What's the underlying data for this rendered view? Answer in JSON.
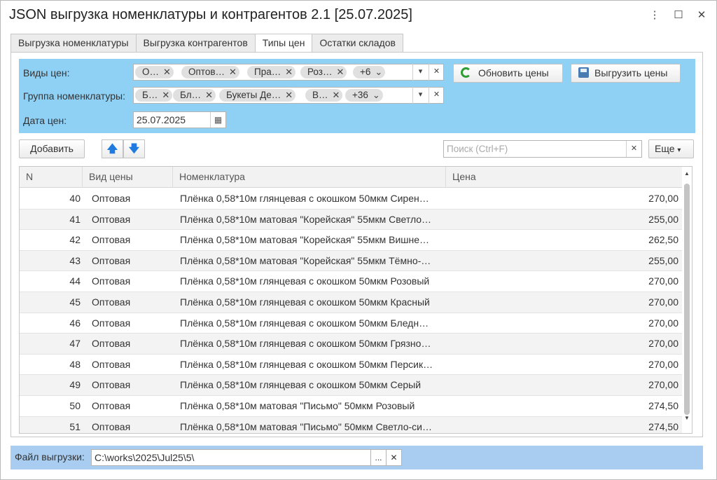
{
  "window": {
    "title": "JSON выгрузка номенклатуры и контрагентов 2.1 [25.07.2025]",
    "more_icon": "⋮",
    "maximize_icon": "☐",
    "close_icon": "✕"
  },
  "tabs": [
    {
      "label": "Выгрузка номенклатуры",
      "active": false
    },
    {
      "label": "Выгрузка контрагентов",
      "active": false
    },
    {
      "label": "Типы цен",
      "active": true
    },
    {
      "label": "Остатки складов",
      "active": false
    }
  ],
  "filter": {
    "background": "#8fd0f5",
    "price_types": {
      "label": "Виды цен:",
      "chips": [
        "О…",
        "Оптов…",
        "Пра…",
        "Роз…"
      ],
      "more": "+6"
    },
    "nom_group": {
      "label": "Группа номенклатуры:",
      "chips": [
        "Б…",
        "Бл…",
        "Букеты Де…",
        "В…"
      ],
      "more": "+36"
    },
    "date": {
      "label": "Дата цен:",
      "value": "25.07.2025"
    },
    "refresh_button": "Обновить цены",
    "export_button": "Выгрузить цены"
  },
  "toolbar": {
    "add_button": "Добавить",
    "move_up_icon": "🡅",
    "move_down_icon": "🡇",
    "search_placeholder": "Поиск (Ctrl+F)",
    "more_button": "Еще"
  },
  "table": {
    "columns": [
      "N",
      "Вид цены",
      "Номенклатура",
      "Цена"
    ],
    "rows": [
      {
        "n": "40",
        "type": "Оптовая",
        "nom": "Плёнка 0,58*10м глянцевая с окошком 50мкм Сирен…",
        "price": "270,00"
      },
      {
        "n": "41",
        "type": "Оптовая",
        "nom": "Плёнка 0,58*10м матовая \"Корейская\" 55мкм Светло…",
        "price": "255,00"
      },
      {
        "n": "42",
        "type": "Оптовая",
        "nom": "Плёнка 0,58*10м матовая \"Корейская\" 55мкм Вишне…",
        "price": "262,50"
      },
      {
        "n": "43",
        "type": "Оптовая",
        "nom": "Плёнка 0,58*10м матовая \"Корейская\" 55мкм Тёмно-…",
        "price": "255,00"
      },
      {
        "n": "44",
        "type": "Оптовая",
        "nom": "Плёнка 0,58*10м глянцевая с окошком 50мкм Розовый",
        "price": "270,00"
      },
      {
        "n": "45",
        "type": "Оптовая",
        "nom": "Плёнка 0,58*10м глянцевая с окошком 50мкм Красный",
        "price": "270,00"
      },
      {
        "n": "46",
        "type": "Оптовая",
        "nom": "Плёнка 0,58*10м глянцевая с окошком 50мкм Бледн…",
        "price": "270,00"
      },
      {
        "n": "47",
        "type": "Оптовая",
        "nom": "Плёнка 0,58*10м глянцевая с окошком 50мкм Грязно…",
        "price": "270,00"
      },
      {
        "n": "48",
        "type": "Оптовая",
        "nom": "Плёнка 0,58*10м глянцевая с окошком 50мкм Персик…",
        "price": "270,00"
      },
      {
        "n": "49",
        "type": "Оптовая",
        "nom": "Плёнка 0,58*10м глянцевая с окошком 50мкм Серый",
        "price": "270,00"
      },
      {
        "n": "50",
        "type": "Оптовая",
        "nom": "Плёнка 0,58*10м матовая \"Письмо\" 50мкм Розовый",
        "price": "274,50"
      },
      {
        "n": "51",
        "type": "Оптовая",
        "nom": "Плёнка 0,58*10м матовая \"Письмо\" 50мкм Светло-си…",
        "price": "274,50"
      }
    ]
  },
  "footer": {
    "label": "Файл выгрузки:",
    "path": "C:\\works\\2025\\Jul25\\5\\",
    "browse_button": "...",
    "clear_icon": "✕",
    "background": "#a8cdf0"
  }
}
